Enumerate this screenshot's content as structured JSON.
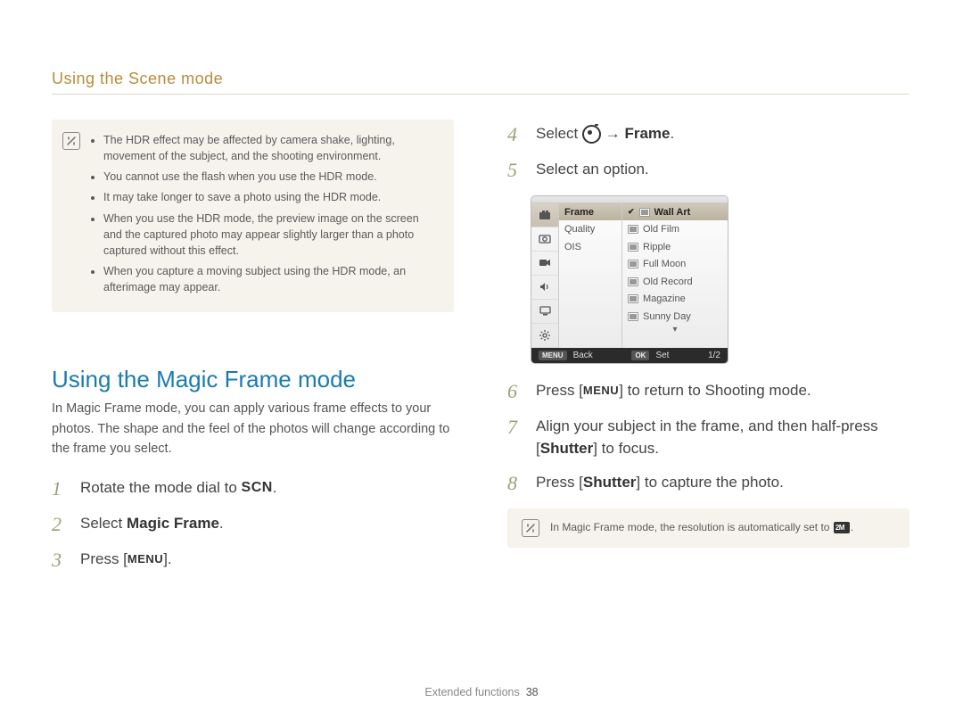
{
  "header": {
    "breadcrumb": "Using the Scene mode"
  },
  "left": {
    "note_items": [
      "The HDR effect may be affected by camera shake, lighting, movement of the subject, and the shooting environment.",
      "You cannot use the flash when you use the HDR mode.",
      "It may take longer to save a photo using the HDR mode.",
      "When you use the HDR mode, the preview image on the screen and the captured photo may appear slightly larger than a photo captured without this effect.",
      "When you capture a moving subject using the HDR mode, an afterimage may appear."
    ],
    "section_title": "Using the Magic Frame mode",
    "section_intro": "In Magic Frame mode, you can apply various frame effects to your photos. The shape and the feel of the photos will change according to the frame you select.",
    "steps": {
      "s1_a": "Rotate the mode dial to ",
      "s1_scn": "SCN",
      "s1_b": ".",
      "s2_a": "Select ",
      "s2_bold": "Magic Frame",
      "s2_b": ".",
      "s3_a": "Press [",
      "s3_menu": "MENU",
      "s3_b": "]."
    }
  },
  "right": {
    "steps": {
      "s4_a": "Select ",
      "s4_arrow": " → ",
      "s4_bold": "Frame",
      "s4_b": ".",
      "s5": "Select an option.",
      "s6_a": "Press [",
      "s6_menu": "MENU",
      "s6_b": "] to return to Shooting mode.",
      "s7_a": "Align your subject in the frame, and then half-press [",
      "s7_bold": "Shutter",
      "s7_b": "] to focus.",
      "s8_a": "Press [",
      "s8_bold": "Shutter",
      "s8_b": "] to capture the photo."
    },
    "cam_menu": {
      "left_items": [
        "Frame",
        "Quality",
        "OIS"
      ],
      "right_items": [
        "Wall Art",
        "Old Film",
        "Ripple",
        "Full Moon",
        "Old Record",
        "Magazine",
        "Sunny Day"
      ],
      "footer_back": "Back",
      "footer_set": "Set",
      "footer_page": "1/2",
      "footer_menu_btn": "MENU",
      "footer_ok_btn": "OK"
    },
    "note_inline": "In Magic Frame mode, the resolution is automatically set to "
  },
  "footer": {
    "section": "Extended functions",
    "page": "38"
  }
}
